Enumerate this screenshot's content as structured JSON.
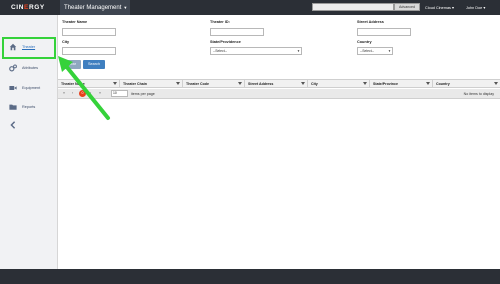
{
  "header": {
    "logo_text_1": "CIN",
    "logo_text_2": "E",
    "logo_text_3": "RGY",
    "app_title": "Theater Management",
    "search_placeholder": "",
    "advanced_label": "Advanced",
    "org_label": "Cloud Cinemas",
    "user_label": "John Doe"
  },
  "sidebar": {
    "items": [
      {
        "label": "Theater",
        "icon": "home-icon"
      },
      {
        "label": "Attributes",
        "icon": "gears-icon"
      },
      {
        "label": "Equipment",
        "icon": "video-camera-icon"
      },
      {
        "label": "Reports",
        "icon": "folder-icon"
      }
    ],
    "collapse_icon": "chevron-left-icon"
  },
  "filters": {
    "theater_name_label": "Theater Name",
    "theater_name_value": "",
    "theater_id_label": "Theater ID:",
    "theater_id_value": "",
    "street_address_label": "Street Address",
    "street_address_value": "",
    "city_label": "City",
    "city_value": "",
    "state_label": "State/Providence",
    "state_value": "--Select--",
    "country_label": "Country",
    "country_value": "--Select--",
    "clear_label": "Clear",
    "search_label": "Search"
  },
  "grid": {
    "columns": [
      "Theater Name",
      "Theater Chain",
      "Theater Code",
      "Street Address",
      "City",
      "State/Province",
      "Country"
    ],
    "pager": {
      "first": "«",
      "prev": "‹",
      "current_page": "0",
      "next": "›",
      "last": "»",
      "page_size": "10",
      "page_size_label": "items per page",
      "empty_message": "No items to display"
    }
  },
  "colors": {
    "topbar": "#2b2f36",
    "accent_orange": "#e8401c",
    "highlight_green": "#35d23a",
    "search_button": "#3f7fc0"
  }
}
